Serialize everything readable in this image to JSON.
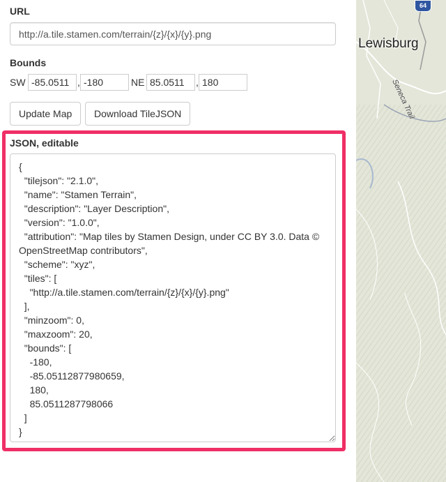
{
  "url": {
    "label": "URL",
    "value": "http://a.tile.stamen.com/terrain/{z}/{x}/{y}.png"
  },
  "bounds": {
    "label": "Bounds",
    "sw_label": "SW",
    "sw_lat": "-85.0511",
    "sw_lng": "-180",
    "ne_label": "NE",
    "ne_lat": "85.0511",
    "ne_lng": "180",
    "separator": ","
  },
  "buttons": {
    "update_map": "Update Map",
    "download_tilejson": "Download TileJSON"
  },
  "json_editor": {
    "label": "JSON, editable",
    "content": "{\n  \"tilejson\": \"2.1.0\",\n  \"name\": \"Stamen Terrain\",\n  \"description\": \"Layer Description\",\n  \"version\": \"1.0.0\",\n  \"attribution\": \"Map tiles by Stamen Design, under CC BY 3.0. Data © OpenStreetMap contributors\",\n  \"scheme\": \"xyz\",\n  \"tiles\": [\n    \"http://a.tile.stamen.com/terrain/{z}/{x}/{y}.png\"\n  ],\n  \"minzoom\": 0,\n  \"maxzoom\": 20,\n  \"bounds\": [\n    -180,\n    -85.05112877980659,\n    180,\n    85.0511287798066\n  ]\n}",
    "highlight_color": "#ef2f66"
  },
  "map": {
    "city_label": "Lewisburg",
    "trail_label": "Seneca Trail",
    "route_shield": "64",
    "shield_color": "#2f56a0",
    "terrain_color": "#e3e6d8"
  }
}
